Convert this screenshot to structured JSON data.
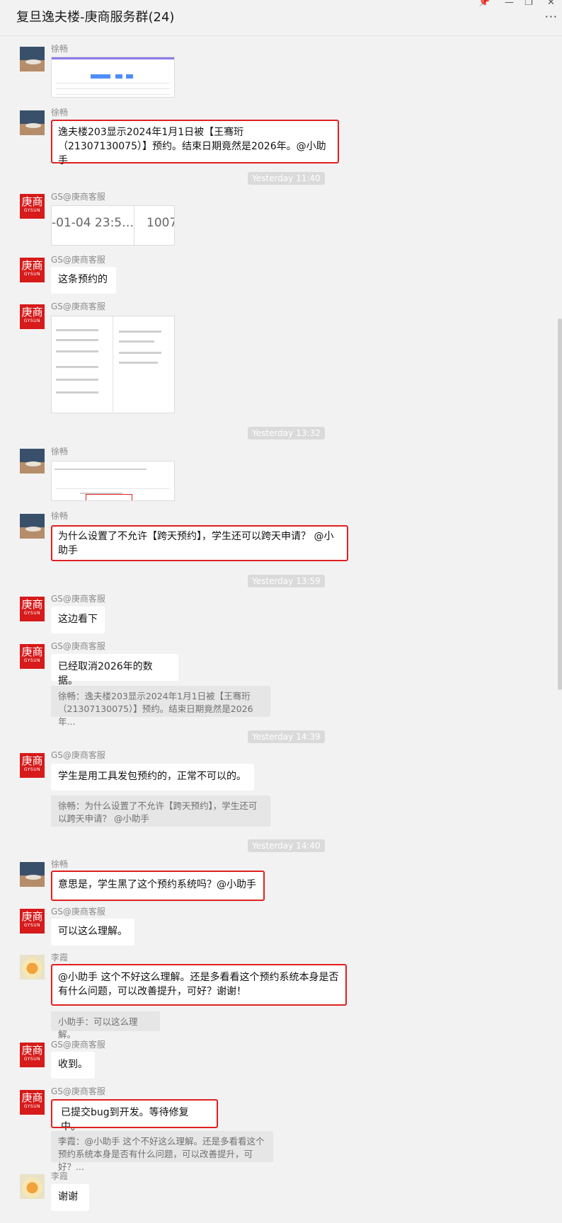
{
  "window": {
    "title": "复旦逸夫楼-庚商服务群(24)",
    "controls": [
      "📌",
      "—",
      "❐",
      "✕"
    ],
    "more": "···"
  },
  "names": {
    "xu": "徐畅",
    "gs": "GS@庚商客服",
    "li": "李霞"
  },
  "avatar_text": {
    "gs_top": "庚商",
    "gs_bottom": "GYSUN"
  },
  "colors": {
    "highlight": "#e02020",
    "gs_red": "#d71a1a",
    "link_blue": "#4f8ef7"
  },
  "messages": {
    "m2": "逸夫楼203显示2024年1月1日被【王骞珩（21307130075）】预约。结束日期竟然是2026年。@小助手",
    "m3_cells": [
      "-01-04 23:5…",
      "1007"
    ],
    "m4": "这条预约的",
    "m7": "为什么设置了不允许【跨天预约】，学生还可以跨天申请？ @小助手",
    "m8": "这边看下",
    "m9": "已经取消2026年的数据。",
    "m9_quote": "徐畅：逸夫楼203显示2024年1月1日被【王骞珩（21307130075）】预约。结束日期竟然是2026年...",
    "m10": "学生是用工具发包预约的，正常不可以的。",
    "m10_quote": "徐畅：为什么设置了不允许【跨天预约】，学生还可以跨天申请？ @小助手",
    "m11": "意思是，学生黑了这个预约系统吗？@小助手",
    "m12": "可以这么理解。",
    "m13": "@小助手 这个不好这么理解。还是多看看这个预约系统本身是否有什么问题，可以改善提升，可好？谢谢！",
    "m13_quote": "小助手：可以这么理解。",
    "m14": "收到。",
    "m15": "已提交bug到开发。等待修复中。",
    "m15_quote": "李霞：@小助手 这个不好这么理解。还是多看看这个预约系统本身是否有什么问题，可以改善提升，可好？...",
    "m16": "谢谢"
  },
  "times": {
    "t1": "Yesterday 11:40",
    "t2": "Yesterday 13:32",
    "t3": "Yesterday 13:59",
    "t4": "Yesterday 14:39",
    "t5": "Yesterday 14:40"
  }
}
